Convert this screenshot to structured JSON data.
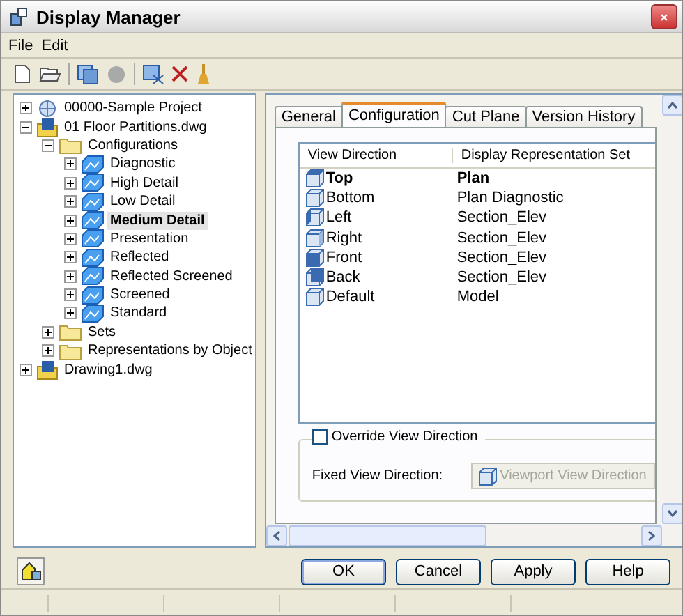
{
  "window": {
    "title": "Display Manager"
  },
  "menu": [
    "File",
    "Edit"
  ],
  "tree": [
    {
      "label": "00000-Sample Project",
      "kind": "project",
      "expanded": false,
      "selected": false
    },
    {
      "label": "01 Floor Partitions.dwg",
      "kind": "drawing",
      "expanded": true,
      "selected": false,
      "children": [
        {
          "label": "Configurations",
          "kind": "folder",
          "expanded": true,
          "selected": false,
          "children": [
            {
              "label": "Diagnostic",
              "kind": "config",
              "expanded": false,
              "selected": false
            },
            {
              "label": "High Detail",
              "kind": "config",
              "expanded": false,
              "selected": false
            },
            {
              "label": "Low Detail",
              "kind": "config",
              "expanded": false,
              "selected": false
            },
            {
              "label": "Medium Detail",
              "kind": "config",
              "expanded": false,
              "selected": true
            },
            {
              "label": "Presentation",
              "kind": "config",
              "expanded": false,
              "selected": false
            },
            {
              "label": "Reflected",
              "kind": "config",
              "expanded": false,
              "selected": false
            },
            {
              "label": "Reflected Screened",
              "kind": "config",
              "expanded": false,
              "selected": false
            },
            {
              "label": "Screened",
              "kind": "config",
              "expanded": false,
              "selected": false
            },
            {
              "label": "Standard",
              "kind": "config",
              "expanded": false,
              "selected": false
            }
          ]
        },
        {
          "label": "Sets",
          "kind": "folder",
          "expanded": false,
          "selected": false
        },
        {
          "label": "Representations by Object",
          "kind": "folder",
          "expanded": false,
          "selected": false
        }
      ]
    },
    {
      "label": "Drawing1.dwg",
      "kind": "drawing",
      "expanded": false,
      "selected": false
    }
  ],
  "tabs": [
    {
      "label": "General",
      "selected": false
    },
    {
      "label": "Configuration",
      "selected": true
    },
    {
      "label": "Cut Plane",
      "selected": false
    },
    {
      "label": "Version History",
      "selected": false
    }
  ],
  "list": {
    "columns": [
      "View Direction",
      "Display Representation Set"
    ],
    "rows": [
      {
        "direction": "Top",
        "set": "Plan",
        "current": true
      },
      {
        "direction": "Bottom",
        "set": "Plan Diagnostic",
        "current": false
      },
      {
        "direction": "Left",
        "set": "Section_Elev",
        "current": false
      },
      {
        "direction": "Right",
        "set": "Section_Elev",
        "current": false
      },
      {
        "direction": "Front",
        "set": "Section_Elev",
        "current": false
      },
      {
        "direction": "Back",
        "set": "Section_Elev",
        "current": false
      },
      {
        "direction": "Default",
        "set": "Model",
        "current": false
      }
    ]
  },
  "override": {
    "label": "Override View Direction",
    "checked": false,
    "fixed_label": "Fixed View Direction:",
    "fixed_value": "Viewport View Direction",
    "disabled": true
  },
  "buttons": [
    "OK",
    "Cancel",
    "Apply",
    "Help"
  ]
}
